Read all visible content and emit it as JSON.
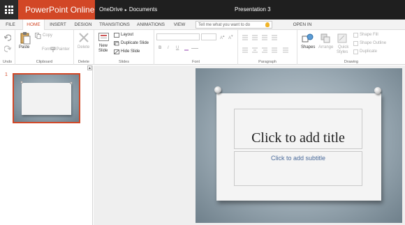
{
  "titlebar": {
    "app_name": "PowerPoint Online",
    "breadcrumb_root": "OneDrive",
    "breadcrumb_sep": "▸",
    "breadcrumb_folder": "Documents",
    "doc_title": "Presentation 3"
  },
  "tabs": [
    "FILE",
    "HOME",
    "INSERT",
    "DESIGN",
    "TRANSITIONS",
    "ANIMATIONS",
    "VIEW"
  ],
  "active_tab": "HOME",
  "tell_me": {
    "placeholder": "Tell me what you want to do"
  },
  "open_in": "OPEN IN POWERPOINT",
  "ribbon": {
    "undo": {
      "label": "Undo"
    },
    "clipboard": {
      "paste": "Paste",
      "copy": "Copy",
      "format_painter": "Format Painter",
      "label": "Clipboard"
    },
    "delete": {
      "delete": "Delete",
      "label": "Delete"
    },
    "slides": {
      "new_slide_1": "New",
      "new_slide_2": "Slide",
      "layout": "Layout",
      "duplicate": "Duplicate Slide",
      "hide": "Hide Slide",
      "label": "Slides"
    },
    "font": {
      "bold": "B",
      "italic": "I",
      "underline": "U",
      "label": "Font"
    },
    "paragraph": {
      "label": "Paragraph"
    },
    "drawing": {
      "shapes": "Shapes",
      "arrange": "Arrange",
      "quick_styles_1": "Quick",
      "quick_styles_2": "Styles",
      "shape_fill": "Shape Fill",
      "shape_outline": "Shape Outline",
      "duplicate": "Duplicate",
      "label": "Drawing"
    }
  },
  "slide_panel": {
    "slide_number": "1",
    "scroll_up": "▲"
  },
  "slide": {
    "title_placeholder": "Click to add title",
    "subtitle_placeholder": "Click to add subtitle"
  },
  "colors": {
    "accent": "#d24726",
    "titlebar": "#1f1f1f",
    "subtitle_text": "#4a6a9a"
  }
}
